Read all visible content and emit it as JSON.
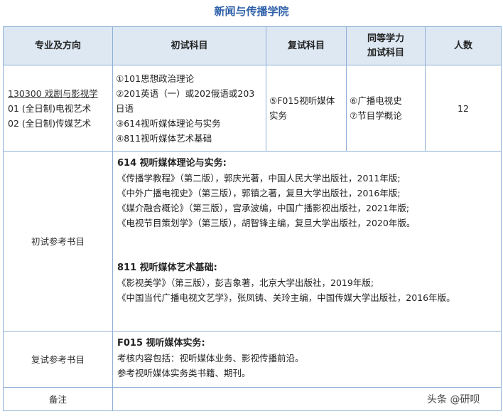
{
  "title": "新闻与传播学院",
  "headers": {
    "major": "专业及方向",
    "initial": "初试科目",
    "retest": "复试科目",
    "equiv_line1": "同等学力",
    "equiv_line2": "加试科目",
    "count": "人数"
  },
  "row": {
    "major_code": "130300 戏剧与影视学",
    "directions": [
      "01 (全日制)电视艺术",
      "02 (全日制)传媒艺术"
    ],
    "initial_subjects": [
      "①101思想政治理论",
      "②201英语（一）或202俄语或203日语",
      "③614视听媒体理论与实务",
      "④811视听媒体艺术基础"
    ],
    "retest_subject": "⑤F015视听媒体实务",
    "equiv_subjects": [
      "⑥广播电视史",
      "⑦节目学概论"
    ],
    "count": "12"
  },
  "initial_refs": {
    "label": "初试参考书目",
    "sections": [
      {
        "title": "614 视听媒体理论与实务:",
        "books": [
          "《传播学教程》（第二版），郭庆光著，中国人民大学出版社，2011年版;",
          "《中外广播电视史》（第三版），郭镇之著，复旦大学出版社，2016年版;",
          "《媒介融合概论》（第三版），宫承波编，中国广播影视出版社，2021年版;",
          "《电视节目策划学》（第三版），胡智锋主编，复旦大学出版社，2020年版。"
        ]
      },
      {
        "title": "811 视听媒体艺术基础:",
        "books": [
          "《影视美学》（第三版），彭吉象著，北京大学出版社，2019年版;",
          "《中国当代广播电视文艺学》，张凤铸、关玲主编，中国传媒大学出版社，2016年版。"
        ]
      }
    ]
  },
  "retest_refs": {
    "label": "复试参考书目",
    "title": "F015 视听媒体实务:",
    "lines": [
      "考核内容包括：视听媒体业务、影视传播前沿。",
      "参考视听媒体实务类书籍、期刊。"
    ]
  },
  "notes": {
    "label": "备注",
    "value": ""
  },
  "watermark": "头条 @研呗"
}
